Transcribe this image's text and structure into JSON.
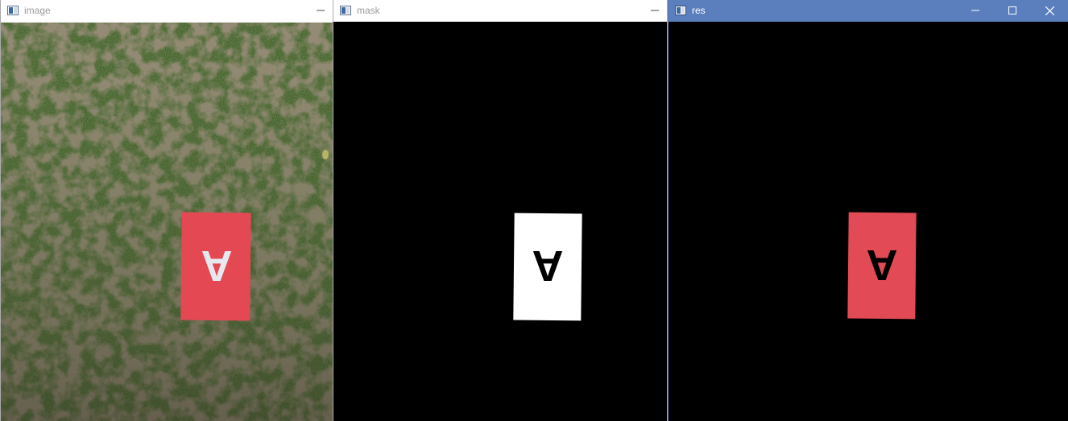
{
  "windows": [
    {
      "title": "image",
      "state": "inactive",
      "content": "photo: red card with white letter on grass"
    },
    {
      "title": "mask",
      "state": "inactive",
      "content": "binary mask: white card, black letter"
    },
    {
      "title": "res",
      "state": "active",
      "content": "masked result: red card on black"
    }
  ],
  "card_glyph": "A",
  "icons": {
    "app": "opencv-window-icon",
    "minimize": "minimize-icon",
    "maximize": "maximize-icon",
    "close": "close-icon"
  },
  "colors": {
    "active_titlebar": "#5b7fbd",
    "inactive_titlebar": "#ffffff",
    "card_red": "#e34a54",
    "grass_green": "#3f5a2a"
  }
}
